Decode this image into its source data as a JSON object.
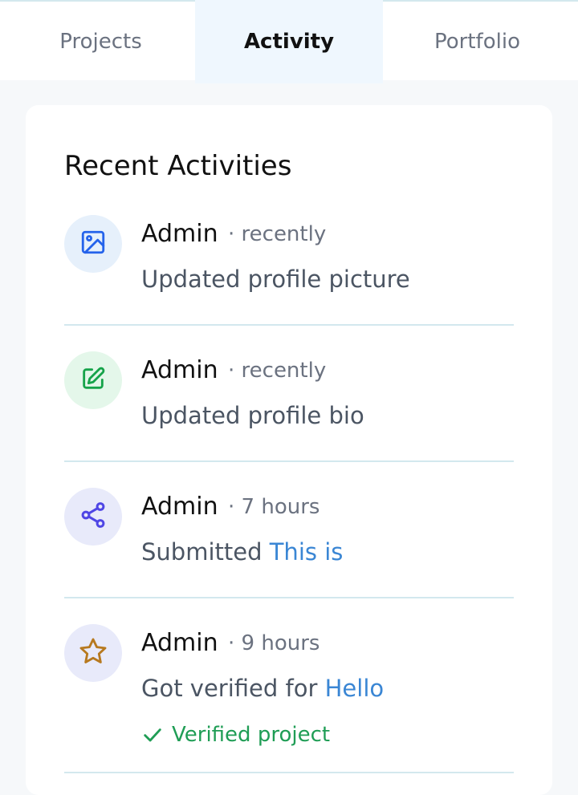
{
  "tabs": [
    {
      "label": "Projects"
    },
    {
      "label": "Activity"
    },
    {
      "label": "Portfolio"
    }
  ],
  "activity": {
    "title": "Recent Activities",
    "items": [
      {
        "user": "Admin",
        "time": "· recently",
        "text": "Updated profile picture",
        "link": "",
        "icon": "image-icon",
        "icon_color": "#2563eb",
        "bg": "#e6f0fb"
      },
      {
        "user": "Admin",
        "time": "· recently",
        "text": "Updated profile bio",
        "link": "",
        "icon": "edit-icon",
        "icon_color": "#16a34a",
        "bg": "#e4f7ea"
      },
      {
        "user": "Admin",
        "time": "· 7 hours",
        "text": "Submitted ",
        "link": "This is",
        "icon": "share-icon",
        "icon_color": "#4f46e5",
        "bg": "#e8eafa"
      },
      {
        "user": "Admin",
        "time": "· 9 hours",
        "text": "Got verified for ",
        "link": "Hello",
        "icon": "star-icon",
        "icon_color": "#b7791f",
        "bg": "#e8eafa",
        "badge": "Verified project"
      }
    ]
  }
}
